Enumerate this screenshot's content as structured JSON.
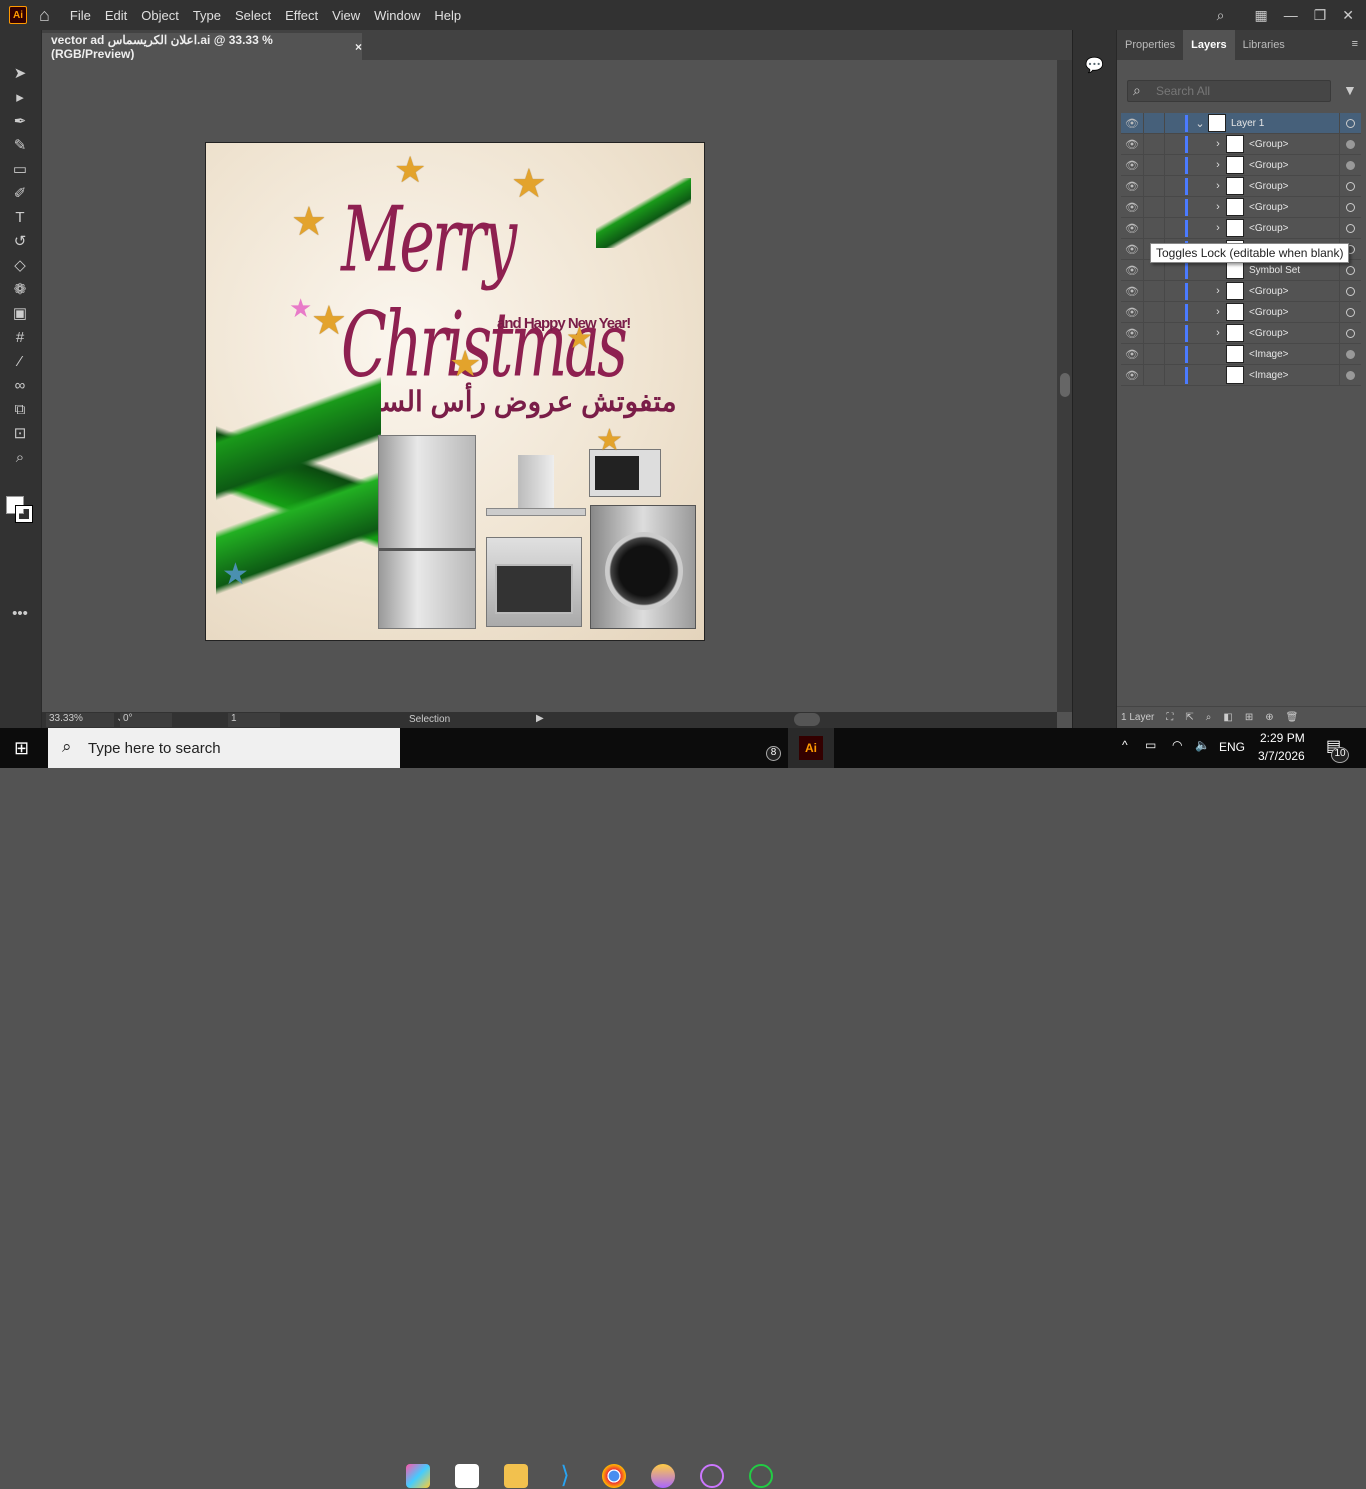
{
  "app": {
    "logo": "Ai",
    "menu": [
      "File",
      "Edit",
      "Object",
      "Type",
      "Select",
      "Effect",
      "View",
      "Window",
      "Help"
    ]
  },
  "document": {
    "tab_title": "vector ad اعلان الكريسماس.ai @ 33.33 % (RGB/Preview)",
    "close": "×"
  },
  "artwork": {
    "title": "Merry Christmas",
    "subtitle": "and Happy New Year!",
    "arabic": "متفوتش عروض رأس السنة"
  },
  "status": {
    "zoom": "33.33%",
    "rotation": "0°",
    "artboard": "1",
    "tool": "Selection"
  },
  "panel": {
    "tabs": [
      "Properties",
      "Layers",
      "Libraries"
    ],
    "active_tab": "Layers",
    "search_placeholder": "Search All",
    "layers": [
      {
        "name": "Layer 1",
        "expanded": true,
        "selected": true,
        "target_filled": false
      },
      {
        "name": "<Group>",
        "target_filled": true
      },
      {
        "name": "<Group>",
        "target_filled": true
      },
      {
        "name": "<Group>",
        "target_filled": false
      },
      {
        "name": "<Group>",
        "target_filled": false
      },
      {
        "name": "<Group>",
        "target_filled": false
      },
      {
        "name": "",
        "target_filled": false
      },
      {
        "name": "Symbol Set",
        "target_filled": false
      },
      {
        "name": "<Group>",
        "target_filled": false
      },
      {
        "name": "<Group>",
        "target_filled": false
      },
      {
        "name": "<Group>",
        "target_filled": false
      },
      {
        "name": "<Image>",
        "target_filled": true
      },
      {
        "name": "<Image>",
        "target_filled": true
      }
    ],
    "tooltip": "Toggles Lock (editable when blank)",
    "footer": "1 Layer"
  },
  "taskbar": {
    "search_placeholder": "Type here to search",
    "time": "2:29 PM",
    "date": "3/7/2026",
    "lang": "ENG",
    "whatsapp_badge": "8",
    "notif_badge": "10"
  }
}
